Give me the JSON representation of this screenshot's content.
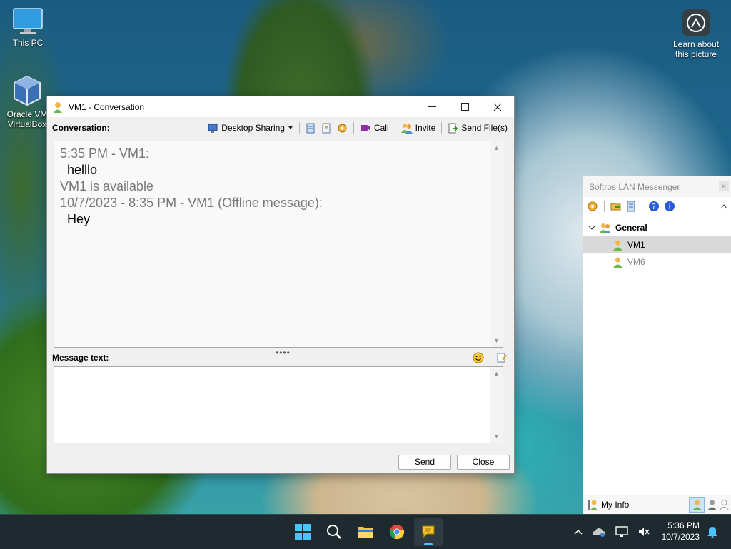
{
  "desktop": {
    "icons": [
      {
        "label": "This PC"
      },
      {
        "label": "Oracle VM VirtualBox"
      },
      {
        "label": "Learn about this picture"
      }
    ]
  },
  "conversation_window": {
    "title": "VM1 - Conversation",
    "conversation_label": "Conversation:",
    "toolbar": {
      "desktop_sharing": "Desktop Sharing",
      "call": "Call",
      "invite": "Invite",
      "send_files": "Send File(s)"
    },
    "history": [
      {
        "kind": "meta",
        "text": "5:35 PM - VM1:"
      },
      {
        "kind": "msg",
        "text": "helllo"
      },
      {
        "kind": "meta",
        "text": "VM1 is available"
      },
      {
        "kind": "meta",
        "text": "10/7/2023 - 8:35 PM - VM1 (Offline message):"
      },
      {
        "kind": "msg",
        "text": "Hey"
      }
    ],
    "message_label": "Message text:",
    "message_value": "",
    "send_label": "Send",
    "close_label": "Close"
  },
  "messenger": {
    "title": "Softros LAN Messenger",
    "group": "General",
    "users": [
      {
        "name": "VM1",
        "selected": true
      },
      {
        "name": "VM6",
        "selected": false
      }
    ],
    "my_info": "My Info"
  },
  "taskbar": {
    "time": "5:36 PM",
    "date": "10/7/2023"
  },
  "colors": {
    "accent_purple": "#8e2ba8",
    "selection_gray": "#d9d9d9",
    "taskbar": "#1f2a30",
    "help_blue": "#2a5bd7"
  }
}
